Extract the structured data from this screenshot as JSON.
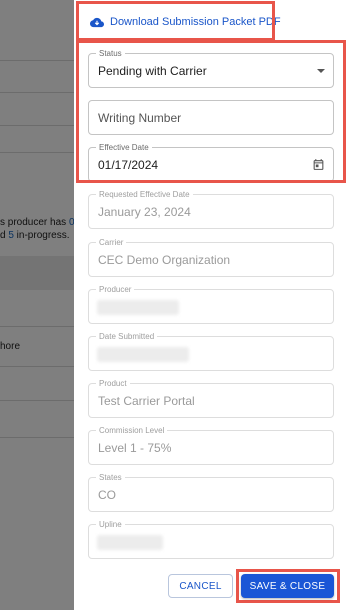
{
  "background": {
    "producer_text_1_prefix": "s producer has ",
    "producer_text_1_link": "0",
    "producer_text_2_link": "d ",
    "producer_text_2_count": "5",
    "producer_text_2_suffix": " in-progress.",
    "row_text": "hore"
  },
  "drawer": {
    "download_link": "Download Submission Packet PDF",
    "status": {
      "label": "Status",
      "value": "Pending with Carrier"
    },
    "writing_number": {
      "placeholder": "Writing Number"
    },
    "effective_date": {
      "label": "Effective Date",
      "value": "01/17/2024"
    },
    "requested_effective_date": {
      "label": "Requested Effective Date",
      "value": "January 23, 2024"
    },
    "carrier": {
      "label": "Carrier",
      "value": "CEC Demo Organization"
    },
    "producer": {
      "label": "Producer",
      "value": ""
    },
    "date_submitted": {
      "label": "Date Submitted",
      "value": ""
    },
    "product": {
      "label": "Product",
      "value": "Test Carrier Portal"
    },
    "commission_level": {
      "label": "Commission Level",
      "value": "Level 1 - 75%"
    },
    "states": {
      "label": "States",
      "value": "CO"
    },
    "upline": {
      "label": "Upline",
      "value": ""
    },
    "cancel_label": "CANCEL",
    "save_label": "SAVE & CLOSE"
  },
  "colors": {
    "accent": "#1a56d6",
    "highlight": "#e8554a",
    "link": "#1a56c9"
  },
  "icons": [
    "cloud-download-icon",
    "caret-down-icon",
    "calendar-icon"
  ]
}
